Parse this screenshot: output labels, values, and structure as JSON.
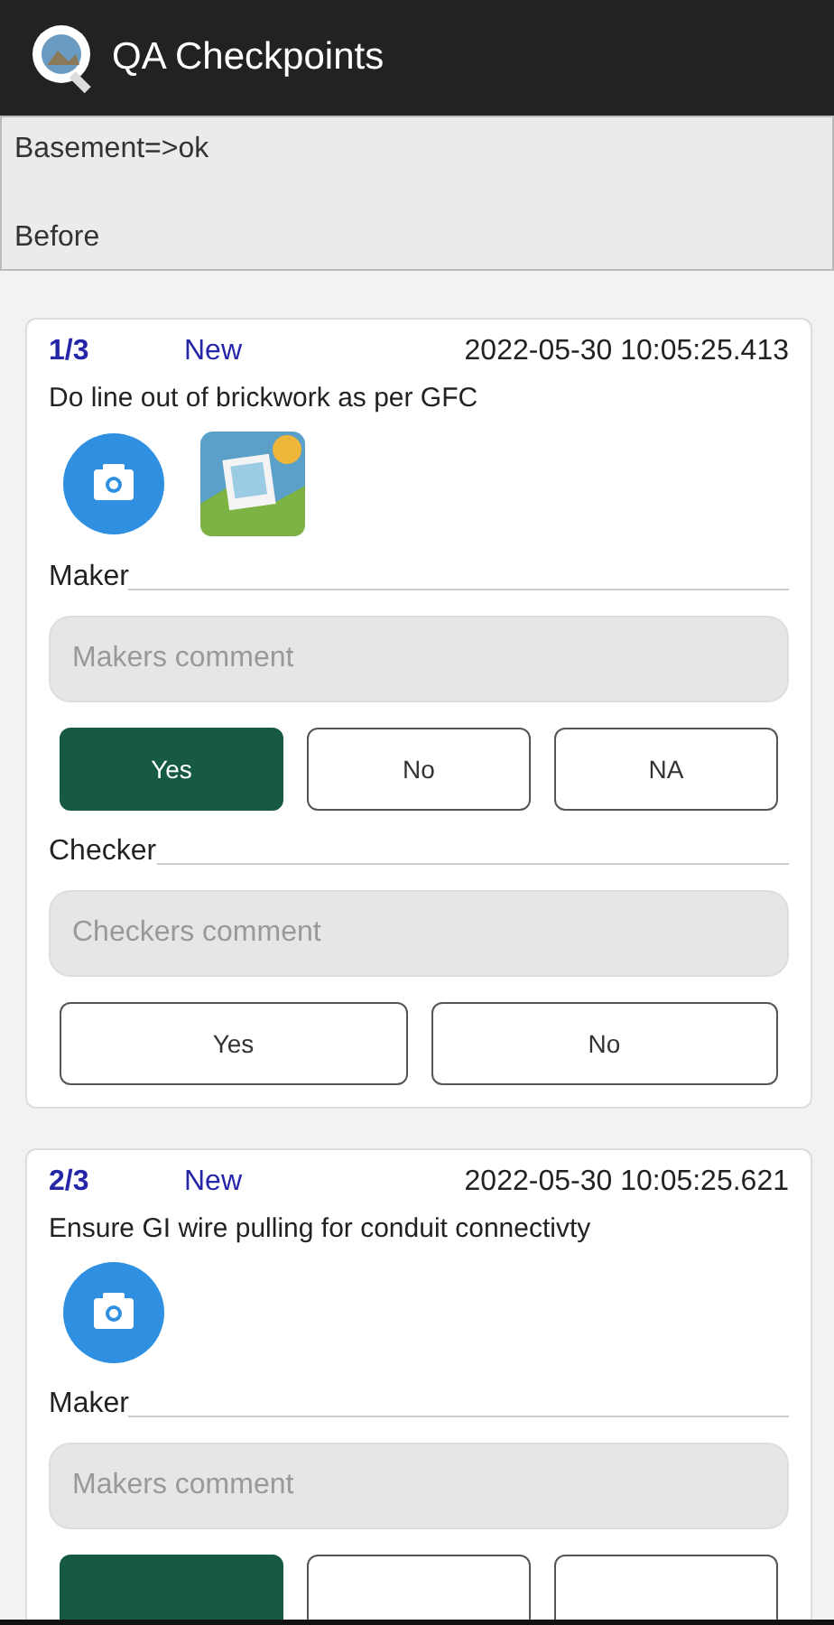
{
  "app_bar": {
    "title": "QA Checkpoints"
  },
  "info": {
    "lines": [
      "Basement=>ok",
      "Before"
    ]
  },
  "checkpoints": [
    {
      "index": "1/3",
      "status": "New",
      "timestamp": "2022-05-30 10:05:25.413",
      "text": "Do line out of brickwork as per GFC",
      "attachments": [
        {
          "kind": "camera"
        },
        {
          "kind": "gallery"
        }
      ],
      "sections": [
        {
          "label": "Maker",
          "placeholder": "Makers comment",
          "options": [
            {
              "label": "Yes",
              "selected": true
            },
            {
              "label": "No",
              "selected": false
            },
            {
              "label": "NA",
              "selected": false
            }
          ]
        },
        {
          "label": "Checker",
          "placeholder": "Checkers comment",
          "options": [
            {
              "label": "Yes",
              "selected": false
            },
            {
              "label": "No",
              "selected": false
            }
          ]
        }
      ]
    },
    {
      "index": "2/3",
      "status": "New",
      "timestamp": "2022-05-30 10:05:25.621",
      "text": "Ensure GI wire pulling for conduit connectivty",
      "attachments": [
        {
          "kind": "camera"
        }
      ],
      "sections": [
        {
          "label": "Maker",
          "placeholder": "Makers comment",
          "options": [
            {
              "selected": true
            },
            {
              "selected": false
            },
            {
              "selected": false
            }
          ]
        }
      ]
    }
  ]
}
